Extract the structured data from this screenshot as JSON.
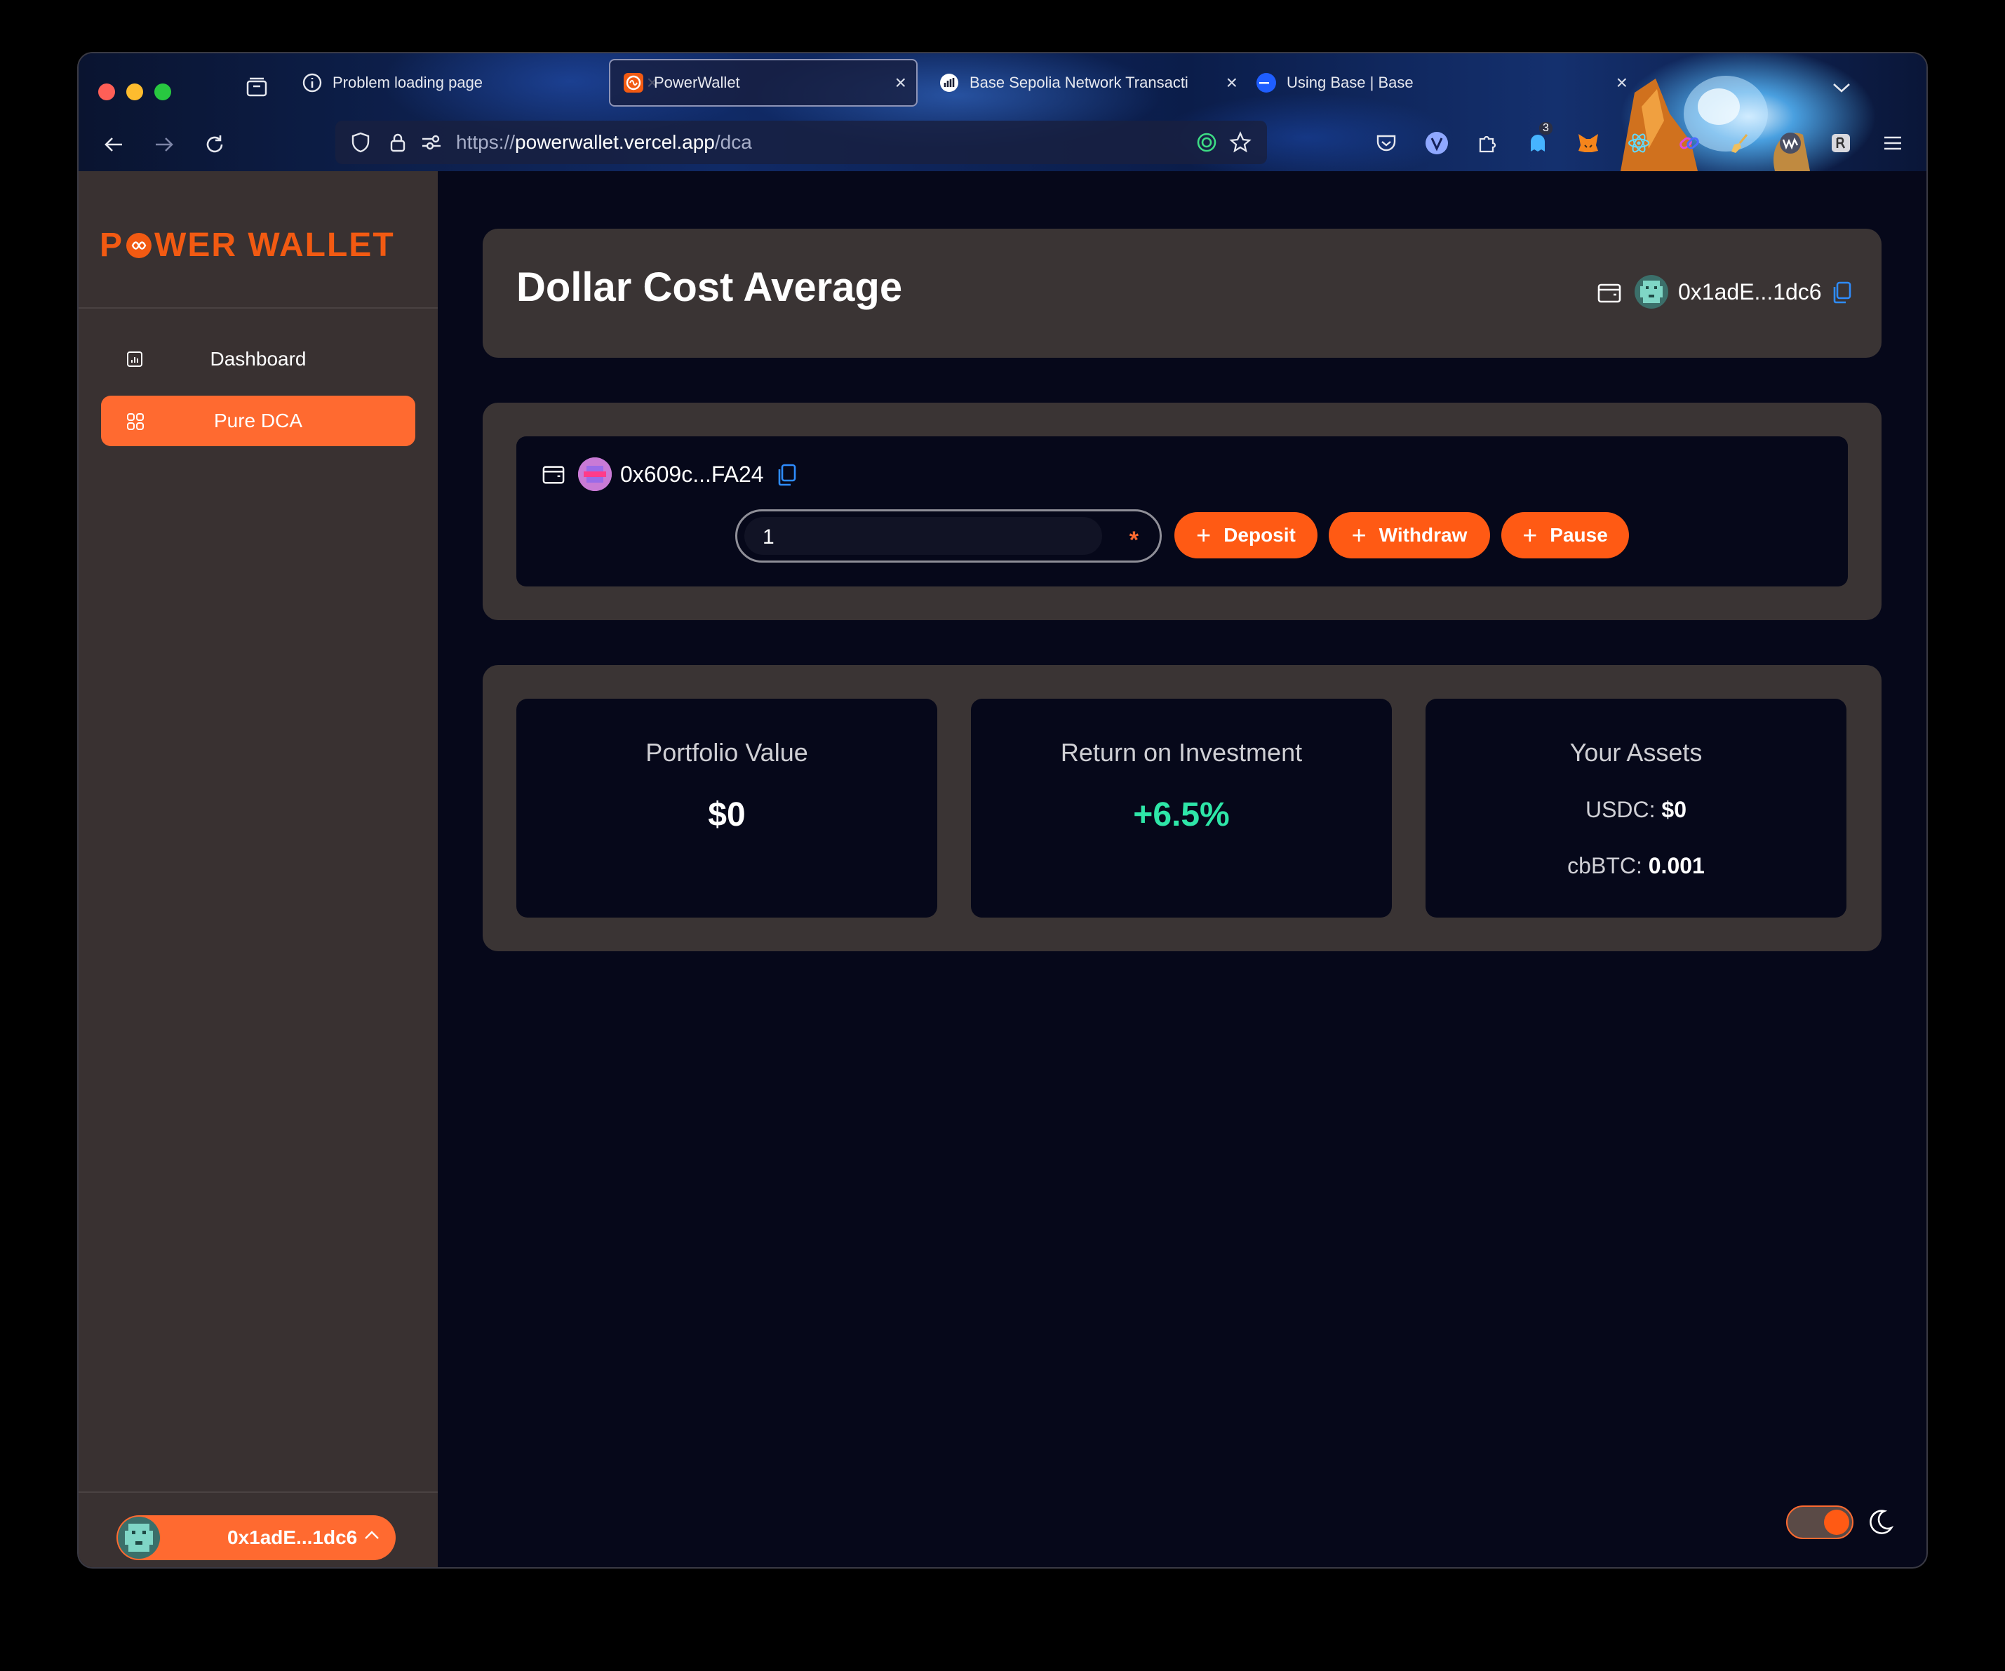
{
  "browser": {
    "tabs": [
      {
        "title": "Problem loading page",
        "icon": "info-circle-icon"
      },
      {
        "title": "PowerWallet",
        "icon": "powerwallet-favicon",
        "active": true
      },
      {
        "title": "Base Sepolia Network Transacti",
        "icon": "basescan-favicon"
      },
      {
        "title": "Using Base | Base",
        "icon": "base-favicon"
      }
    ],
    "url_prefix": "https://",
    "url_host": "powerwallet.vercel.app",
    "url_path": "/dca",
    "extension_badge": "3"
  },
  "sidebar": {
    "logo_part1": "P",
    "logo_part2": "WER WALLET",
    "items": [
      {
        "label": "Dashboard",
        "icon": "chart-icon"
      },
      {
        "label": "Pure DCA",
        "icon": "grid-icon",
        "active": true
      }
    ],
    "account_label": "0x1adE...1dc6"
  },
  "header": {
    "title": "Dollar Cost Average",
    "wallet_address": "0x1adE...1dc6"
  },
  "strategy": {
    "address": "0x609c...FA24",
    "amount_value": "1",
    "required_mark": "*",
    "buttons": {
      "deposit": "Deposit",
      "withdraw": "Withdraw",
      "pause": "Pause"
    }
  },
  "stats": {
    "portfolio_label": "Portfolio Value",
    "portfolio_value": "$0",
    "roi_label": "Return on Investment",
    "roi_value": "+6.5%",
    "assets_label": "Your Assets",
    "usdc_label": "USDC:",
    "usdc_value": "$0",
    "cbbtc_label": "cbBTC:",
    "cbbtc_value": "0.001"
  },
  "colors": {
    "accent": "#ff5a14",
    "roi_positive": "#2ee6a8",
    "panel": "#3a3434",
    "background": "#06081a"
  }
}
